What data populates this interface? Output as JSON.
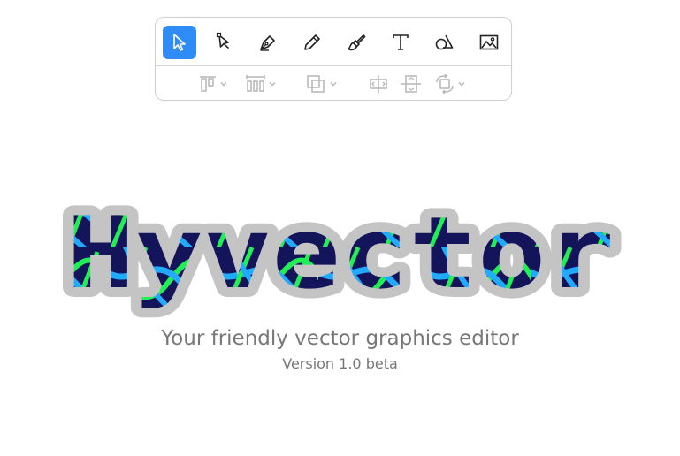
{
  "app": {
    "logo_text": "Hyvector",
    "tagline": "Your friendly vector graphics editor",
    "version": "Version 1.0 beta"
  },
  "toolbar": {
    "tools": [
      {
        "name": "select",
        "icon": "pointer-arrow-icon",
        "active": true
      },
      {
        "name": "direct-select",
        "icon": "node-select-icon",
        "active": false
      },
      {
        "name": "pen",
        "icon": "pen-nib-icon",
        "active": false
      },
      {
        "name": "pencil",
        "icon": "pencil-icon",
        "active": false
      },
      {
        "name": "brush",
        "icon": "paint-brush-icon",
        "active": false
      },
      {
        "name": "text",
        "icon": "text-T-icon",
        "active": false
      },
      {
        "name": "shapes",
        "icon": "shapes-icon",
        "active": false
      },
      {
        "name": "image",
        "icon": "image-icon",
        "active": false
      }
    ],
    "arrange": [
      {
        "name": "align",
        "icon": "align-top-icon",
        "dropdown": true
      },
      {
        "name": "distribute",
        "icon": "distribute-icon",
        "dropdown": true
      },
      {
        "name": "boolean",
        "icon": "boolean-ops-icon",
        "dropdown": true
      },
      {
        "name": "flip-horizontal",
        "icon": "flip-horizontal-icon",
        "dropdown": false
      },
      {
        "name": "flip-vertical",
        "icon": "flip-vertical-icon",
        "dropdown": false
      },
      {
        "name": "transform",
        "icon": "transform-icon",
        "dropdown": true
      }
    ]
  },
  "colors": {
    "accent": "#2f8cf6",
    "logo_fill": "#14145a",
    "logo_outline": "#c4c4c4",
    "logo_stripe_green": "#22ee55",
    "logo_stripe_blue": "#22aaff",
    "text_muted": "#777777",
    "icon_disabled": "#b5b5b5"
  }
}
